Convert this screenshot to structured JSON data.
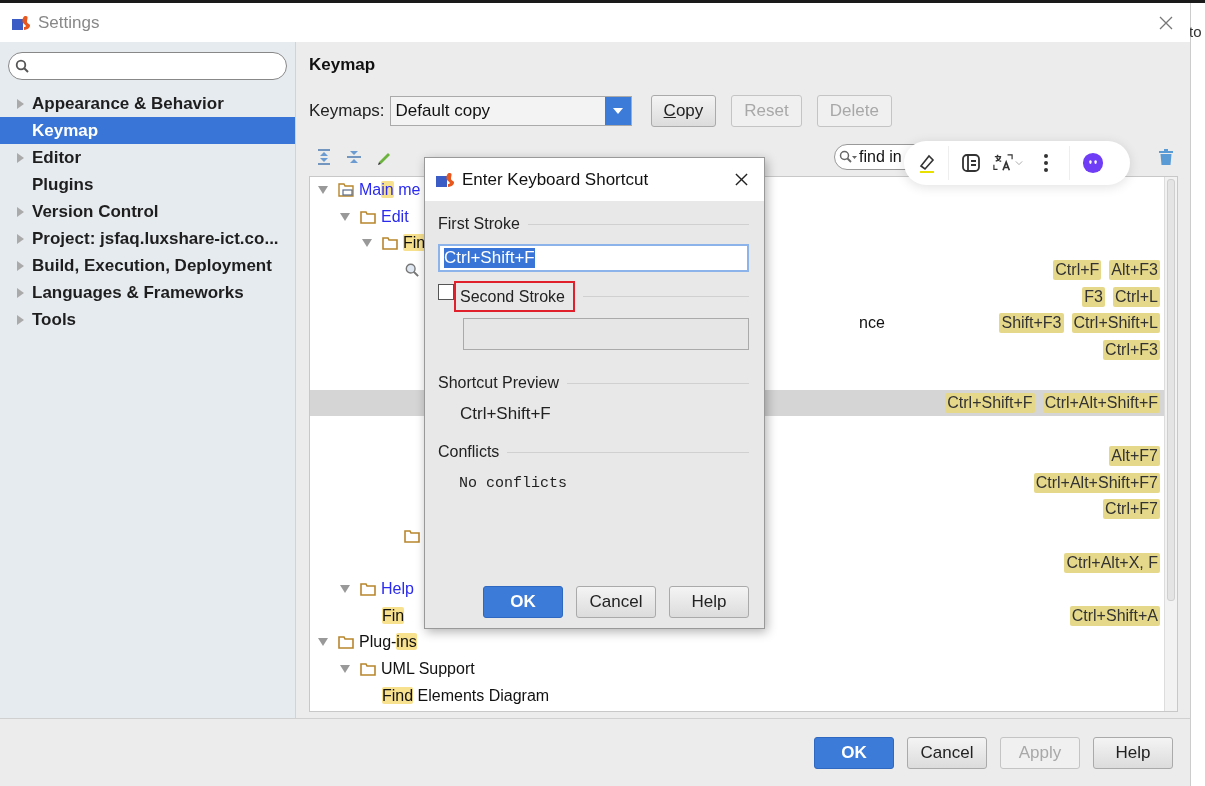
{
  "window": {
    "title": "Settings"
  },
  "sidebar": {
    "items": [
      {
        "label": "Appearance & Behavior",
        "expanded": false,
        "selected": false
      },
      {
        "label": "Keymap",
        "selected": true
      },
      {
        "label": "Editor",
        "expanded": false,
        "selected": false
      },
      {
        "label": "Plugins",
        "selected": false
      },
      {
        "label": "Version Control",
        "expanded": false,
        "selected": false
      },
      {
        "label": "Project: jsfaq.luxshare-ict.co...",
        "expanded": false,
        "selected": false
      },
      {
        "label": "Build, Execution, Deployment",
        "expanded": false,
        "selected": false
      },
      {
        "label": "Languages & Frameworks",
        "expanded": false,
        "selected": false
      },
      {
        "label": "Tools",
        "expanded": false,
        "selected": false
      }
    ]
  },
  "keymap": {
    "title": "Keymap",
    "keymaps_label": "Keymaps:",
    "keymap_value": "Default copy",
    "buttons": [
      {
        "mnemonic": "C",
        "rest": "opy",
        "disabled": false
      },
      {
        "rest": "Reset",
        "disabled": true
      },
      {
        "rest": "Delete",
        "disabled": true
      }
    ],
    "filter": {
      "value": "find in"
    }
  },
  "tree": [
    {
      "kind": "menu",
      "expanded": true,
      "selected": false,
      "label": [
        {
          "text": "Ma"
        },
        {
          "text": "in",
          "match": true
        },
        {
          "text": " me"
        }
      ],
      "children": [
        {
          "kind": "folder",
          "expanded": true,
          "selected": false,
          "label": [
            {
              "text": "Edit"
            }
          ],
          "children": [
            {
              "kind": "folder",
              "expanded": true,
              "selected": false,
              "label": [
                {
                  "text": "Fin",
                  "match": true
                }
              ],
              "children": [
                {
                  "kind": "search",
                  "selected": false,
                  "shortcuts": [
                    "Ctrl+F",
                    "Alt+F3"
                  ]
                },
                {
                  "selected": false,
                  "shortcuts": [
                    "F3",
                    "Ctrl+L"
                  ]
                },
                {
                  "selected": false,
                  "tail": "nce",
                  "shortcuts": [
                    "Shift+F3",
                    "Ctrl+Shift+L"
                  ]
                },
                {
                  "selected": false,
                  "shortcuts": [
                    "Ctrl+F3"
                  ]
                },
                {
                  "selected": false
                },
                {
                  "selected": true,
                  "shortcuts": [
                    "Ctrl+Shift+F",
                    "Ctrl+Alt+Shift+F"
                  ]
                },
                {
                  "selected": false
                },
                {
                  "selected": false,
                  "shortcuts": [
                    "Alt+F7"
                  ]
                },
                {
                  "selected": false,
                  "shortcuts": [
                    "Ctrl+Alt+Shift+F7"
                  ]
                },
                {
                  "selected": false,
                  "shortcuts": [
                    "Ctrl+F7"
                  ]
                },
                {
                  "kind": "folder",
                  "selected": false
                },
                {
                  "selected": false,
                  "shortcuts": [
                    "Ctrl+Alt+X, F"
                  ]
                }
              ]
            }
          ]
        },
        {
          "kind": "folder",
          "expanded": true,
          "selected": false,
          "label": [
            {
              "text": "Help"
            }
          ],
          "children": [
            {
              "selected": false,
              "label": [
                {
                  "text": "Fin",
                  "match": true
                }
              ],
              "shortcuts": [
                "Ctrl+Shift+A"
              ]
            }
          ]
        }
      ]
    },
    {
      "kind": "folder",
      "expanded": true,
      "selected": false,
      "label": [
        {
          "text": "Plug-"
        },
        {
          "text": "ins",
          "match": true
        }
      ],
      "children": [
        {
          "kind": "folder",
          "expanded": true,
          "selected": false,
          "label": [
            {
              "text": "UML Support"
            }
          ],
          "children": [
            {
              "selected": false,
              "label": [
                {
                  "text": "Find",
                  "match": true
                },
                {
                  "text": " Elements Diagram"
                }
              ]
            }
          ]
        }
      ]
    }
  ],
  "dialog": {
    "title": "Enter Keyboard Shortcut",
    "first_stroke_label": "First Stroke",
    "first_stroke_value": "Ctrl+Shift+F",
    "second_stroke": {
      "label": "Second Stroke",
      "checked": false,
      "annotated": true
    },
    "preview_label": "Shortcut Preview",
    "preview_value": "Ctrl+Shift+F",
    "conflicts_label": "Conflicts",
    "conflicts_value": "No conflicts",
    "buttons": [
      {
        "label": "OK",
        "default": true
      },
      {
        "label": "Cancel",
        "default": false
      },
      {
        "label": "Help",
        "default": false
      }
    ]
  },
  "footer_buttons": [
    {
      "label": "OK",
      "default": true,
      "disabled": false
    },
    {
      "label": "Cancel",
      "default": false,
      "disabled": false
    },
    {
      "label": "Apply",
      "default": false,
      "disabled": true
    },
    {
      "label": "Help",
      "default": false,
      "disabled": false
    }
  ],
  "background_page": {
    "text": "to"
  }
}
